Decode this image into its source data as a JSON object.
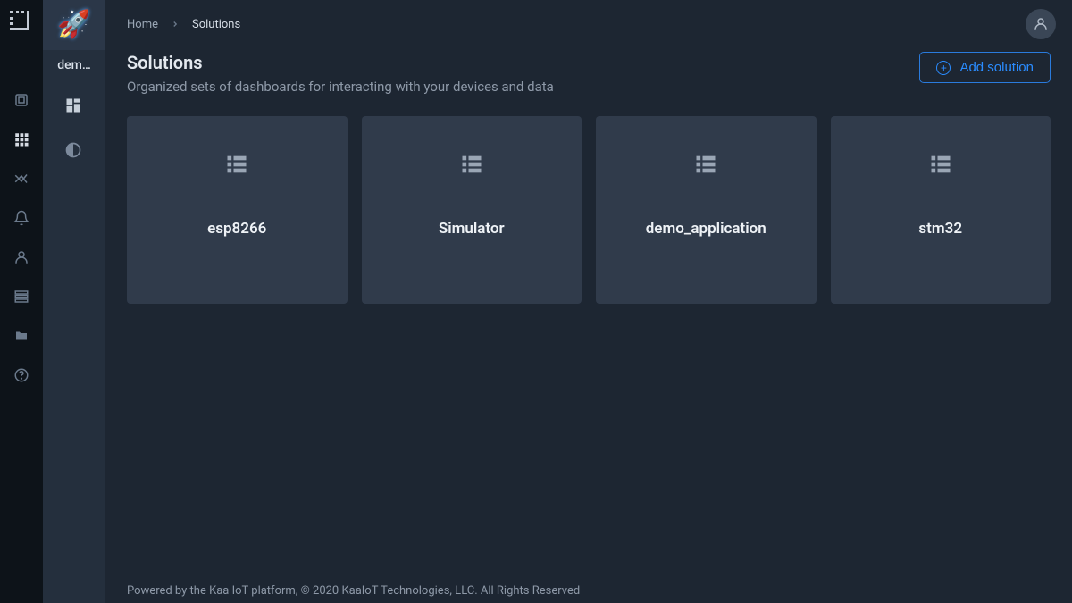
{
  "breadcrumb": {
    "home": "Home",
    "current": "Solutions"
  },
  "sidebar": {
    "tenant_label": "dem…"
  },
  "header": {
    "title": "Solutions",
    "subtitle": "Organized sets of dashboards for interacting with your devices and data",
    "add_button": "Add solution"
  },
  "solutions": [
    {
      "name": "esp8266"
    },
    {
      "name": "Simulator"
    },
    {
      "name": "demo_application"
    },
    {
      "name": "stm32"
    }
  ],
  "footer": {
    "text": "Powered by the Kaa IoT platform, © 2020 KaaIoT Technologies, LLC. All Rights Reserved"
  }
}
